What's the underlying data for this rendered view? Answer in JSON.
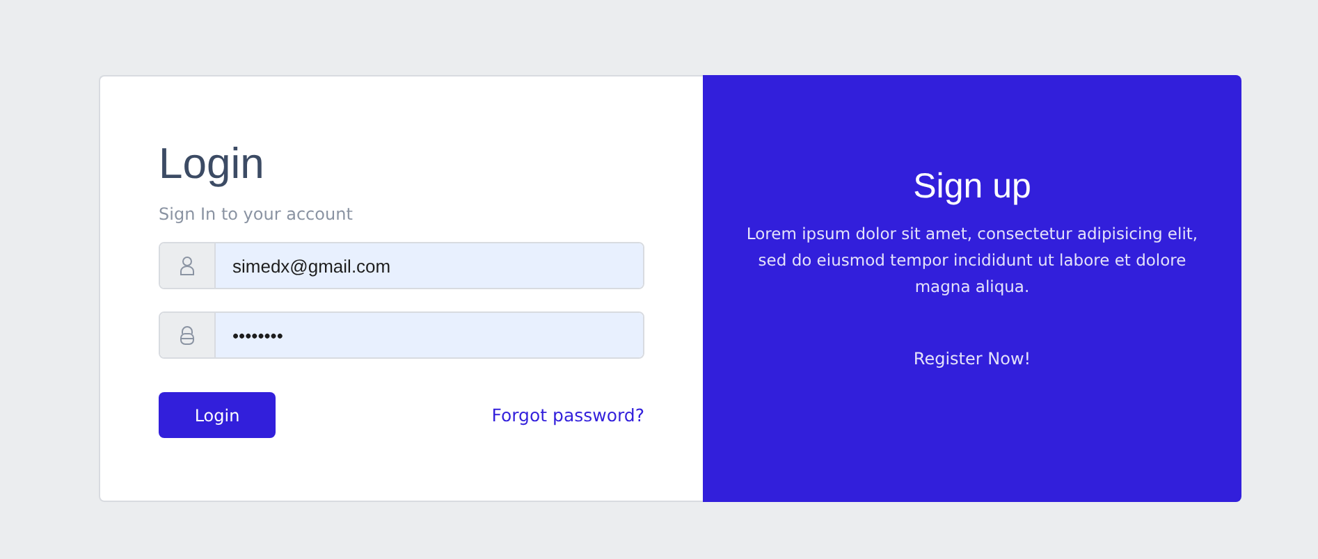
{
  "login": {
    "title": "Login",
    "subtitle": "Sign In to your account",
    "fields": [
      {
        "kind": "user",
        "value": "simedx@gmail.com"
      },
      {
        "kind": "lock",
        "value": "••••••••"
      }
    ],
    "button": "Login",
    "forgot": "Forgot password?"
  },
  "signup": {
    "title": "Sign up",
    "text": "Lorem ipsum dolor sit amet, consectetur adipisicing elit, sed do eiusmod tempor incididunt ut labore et dolore magna aliqua.",
    "button": "Register Now!"
  }
}
